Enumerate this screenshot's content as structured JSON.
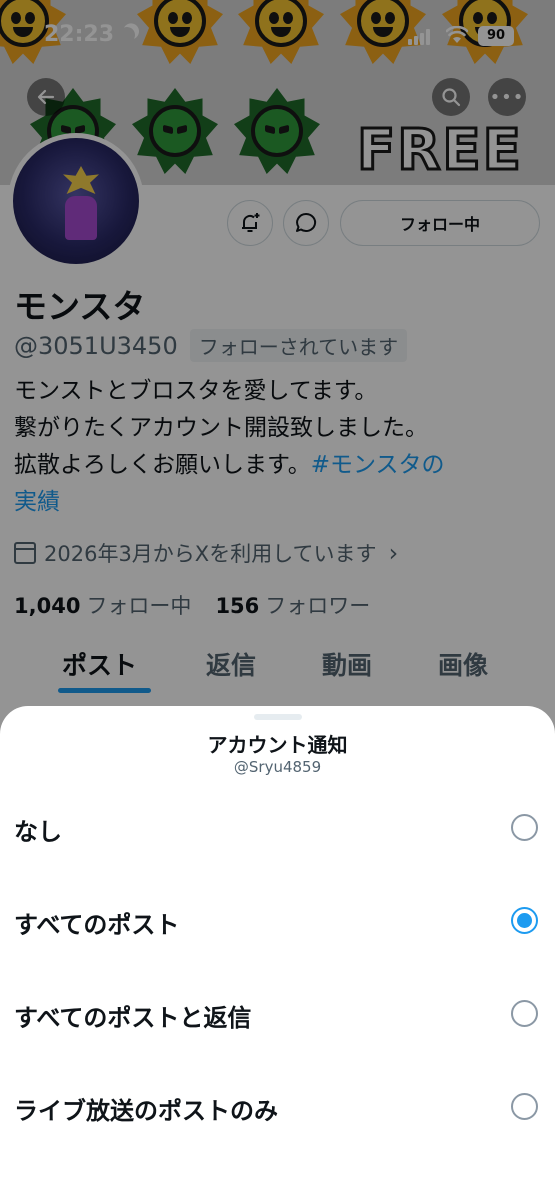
{
  "status_bar": {
    "time": "22:23",
    "battery": "90"
  },
  "banner": {
    "text": "FREE"
  },
  "profile": {
    "name": "モンスタ",
    "handle": "@3051U3450",
    "follows_you": "フォローされています",
    "follow_button": "フォロー中",
    "bio_lines": [
      "モンストとブロスタを愛してます。",
      "繋がりたくアカウント開設致しました。",
      "拡散よろしくお願いします。"
    ],
    "bio_hashtag_part1": "#モンスタの",
    "bio_hashtag_part2": "実績",
    "joined": "2026年3月からXを利用しています",
    "following_count": "1,040",
    "following_label": "フォロー中",
    "followers_count": "156",
    "followers_label": "フォロワー"
  },
  "tabs": [
    {
      "label": "ポスト",
      "active": true
    },
    {
      "label": "返信",
      "active": false
    },
    {
      "label": "動画",
      "active": false
    },
    {
      "label": "画像",
      "active": false
    }
  ],
  "sheet": {
    "title": "アカウント通知",
    "subtitle": "@Sryu4859",
    "options": [
      {
        "label": "なし",
        "selected": false
      },
      {
        "label": "すべてのポスト",
        "selected": true
      },
      {
        "label": "すべてのポストと返信",
        "selected": false
      },
      {
        "label": "ライブ放送のポストのみ",
        "selected": false
      }
    ]
  },
  "colors": {
    "accent": "#1d9bf0",
    "text_primary": "#0f1419",
    "text_secondary": "#536471"
  }
}
